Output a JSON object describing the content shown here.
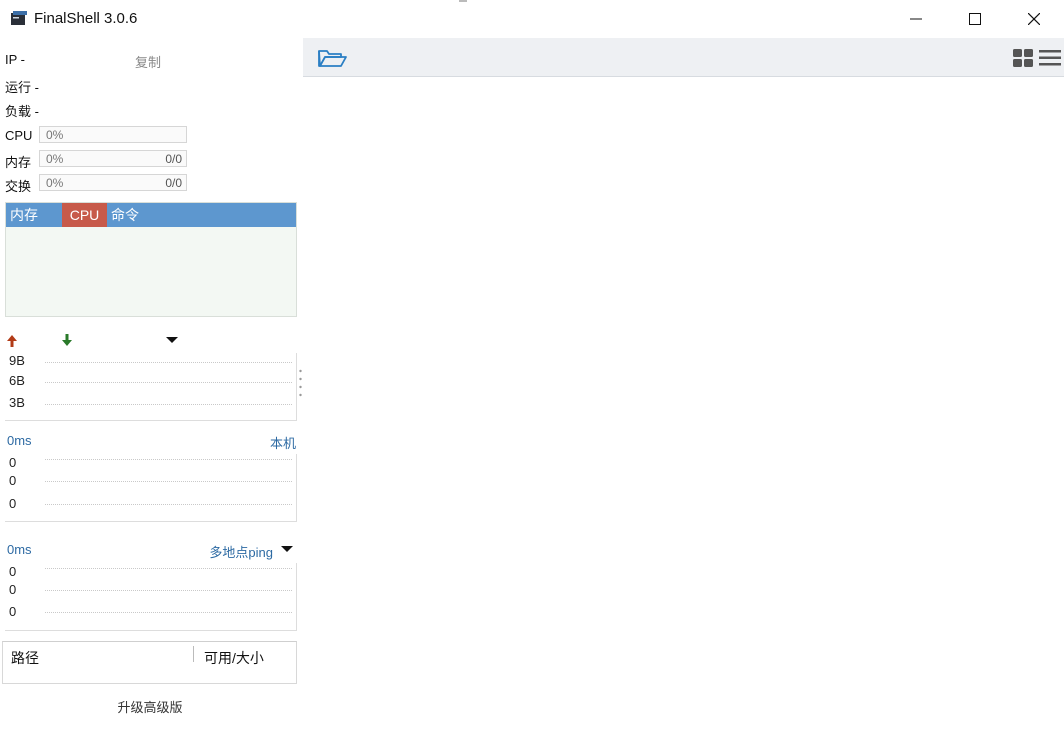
{
  "window": {
    "title": "FinalShell 3.0.6"
  },
  "info": {
    "ip_label": "IP  -",
    "copy_label": "复制",
    "run_label": "运行 -",
    "load_label": "负载 -"
  },
  "meters": {
    "cpu": {
      "label": "CPU",
      "percent": "0%",
      "ratio": ""
    },
    "mem": {
      "label": "内存",
      "percent": "0%",
      "ratio": "0/0"
    },
    "swap": {
      "label": "交换",
      "percent": "0%",
      "ratio": "0/0"
    }
  },
  "process": {
    "tabs": [
      "内存",
      "CPU",
      "命令"
    ],
    "active_tab": "CPU"
  },
  "network": {
    "y_labels": [
      "9B",
      "6B",
      "3B"
    ]
  },
  "latency_local": {
    "ms": "0ms",
    "target": "本机",
    "y_labels": [
      "0",
      "0",
      "0"
    ]
  },
  "latency_multi": {
    "ms": "0ms",
    "target": "多地点ping",
    "y_labels": [
      "0",
      "0",
      "0"
    ]
  },
  "disk": {
    "path_header": "路径",
    "size_header": "可用/大小"
  },
  "upgrade_label": "升级高级版",
  "colors": {
    "accent_blue": "#5d97cf",
    "cpu_red": "#c75a4a",
    "link_blue": "#2d6aa3",
    "up_arrow": "#b23b17",
    "down_arrow": "#2a7a2a"
  }
}
